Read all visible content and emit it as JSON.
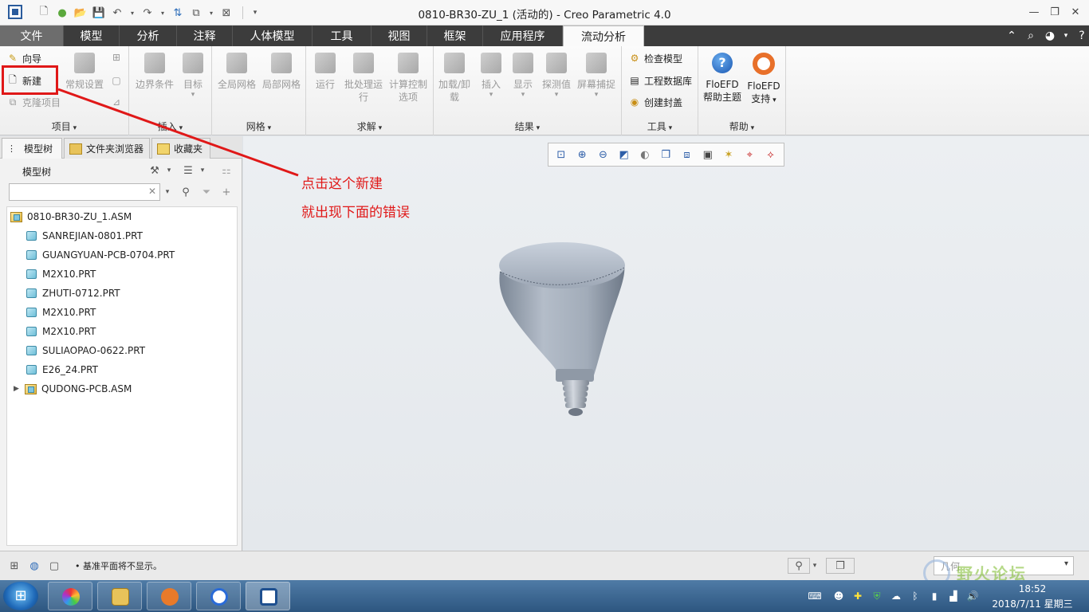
{
  "window": {
    "title": "0810-BR30-ZU_1 (活动的) - Creo Parametric 4.0"
  },
  "ribbon_tabs": [
    {
      "label": "文件"
    },
    {
      "label": "模型"
    },
    {
      "label": "分析"
    },
    {
      "label": "注释"
    },
    {
      "label": "人体模型"
    },
    {
      "label": "工具"
    },
    {
      "label": "视图"
    },
    {
      "label": "框架"
    },
    {
      "label": "应用程序"
    },
    {
      "label": "流动分析",
      "active": true
    }
  ],
  "ribbon": {
    "project": {
      "label": "项目",
      "wizard": "向导",
      "new": "新建",
      "clone": "克隆项目",
      "general_settings": "常规设置"
    },
    "insert": {
      "label": "插入",
      "boundary": "边界条件",
      "goal": "目标"
    },
    "mesh": {
      "label": "网格",
      "global": "全局网格",
      "local": "局部网格"
    },
    "solve": {
      "label": "求解",
      "run": "运行",
      "batch_line1": "批处理运",
      "batch_line2": "行",
      "calc_line1": "计算控制",
      "calc_line2": "选项"
    },
    "results": {
      "label": "结果",
      "load_line1": "加载/卸",
      "load_line2": "载",
      "insert": "插入",
      "display": "显示",
      "probe": "探测值",
      "capture": "屏幕捕捉"
    },
    "tools": {
      "label": "工具",
      "check_model": "检查模型",
      "eng_db": "工程数据库",
      "create_lid": "创建封盖"
    },
    "help": {
      "label": "帮助",
      "help_line1": "FloEFD",
      "help_line2": "帮助主题",
      "support_line1": "FloEFD",
      "support_line2": "支持"
    }
  },
  "panel_tabs": [
    {
      "label": "模型树"
    },
    {
      "label": "文件夹浏览器"
    },
    {
      "label": "收藏夹"
    }
  ],
  "model_tree": {
    "title": "模型树",
    "search_value": "",
    "root": "0810-BR30-ZU_1.ASM",
    "items": [
      {
        "label": "SANREJIAN-0801.PRT",
        "kind": "part"
      },
      {
        "label": "GUANGYUAN-PCB-0704.PRT",
        "kind": "part"
      },
      {
        "label": "M2X10.PRT",
        "kind": "part"
      },
      {
        "label": "ZHUTI-0712.PRT",
        "kind": "part"
      },
      {
        "label": "M2X10.PRT",
        "kind": "part"
      },
      {
        "label": "M2X10.PRT",
        "kind": "part"
      },
      {
        "label": "SULIAOPAO-0622.PRT",
        "kind": "part"
      },
      {
        "label": "E26_24.PRT",
        "kind": "part"
      },
      {
        "label": "QUDONG-PCB.ASM",
        "kind": "asm"
      }
    ]
  },
  "annotation": {
    "line1": "点击这个新建",
    "line2": "就出现下面的错误"
  },
  "statusbar": {
    "message": "• 基准平面将不显示。",
    "filter_value": "几何"
  },
  "taskbar": {
    "time": "18:52",
    "date": "2018/7/11 星期三"
  },
  "watermark": {
    "text": "野火论坛"
  },
  "colors": {
    "annotation_red": "#e01818",
    "tab_bar": "#3c3c3c",
    "model_gray": "#a8b0bc"
  }
}
